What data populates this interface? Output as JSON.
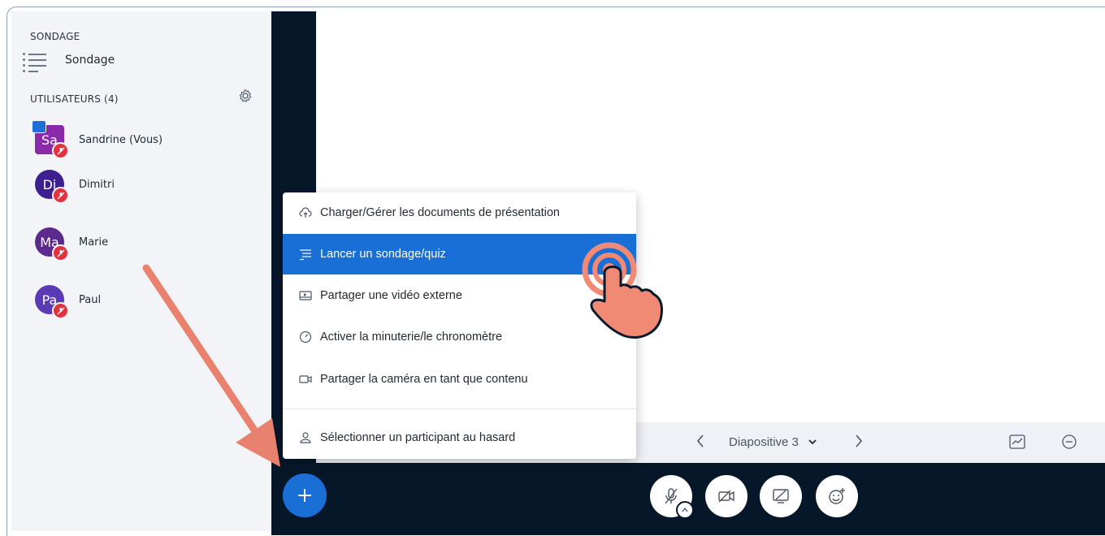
{
  "sidebar": {
    "poll_section_title": "SONDAGE",
    "poll_item_label": "Sondage",
    "users_section_title": "UTILISATEURS (4)",
    "users": [
      {
        "initials": "Sa",
        "name": "Sandrine (Vous)",
        "color": "#8a2aa8"
      },
      {
        "initials": "Di",
        "name": "Dimitri",
        "color": "#3d1f8f"
      },
      {
        "initials": "Ma",
        "name": "Marie",
        "color": "#5b2a8c"
      },
      {
        "initials": "Pa",
        "name": "Paul",
        "color": "#5a3ab5"
      }
    ]
  },
  "menu": {
    "items": [
      {
        "label": "Charger/Gérer les documents de présentation",
        "icon": "cloud-upload-icon"
      },
      {
        "label": "Lancer un sondage/quiz",
        "icon": "poll-icon"
      },
      {
        "label": "Partager une vidéo externe",
        "icon": "external-video-icon"
      },
      {
        "label": "Activer la minuterie/le chronomètre",
        "icon": "timer-icon"
      },
      {
        "label": "Partager la caméra en tant que contenu",
        "icon": "camera-icon"
      },
      {
        "label": "Sélectionner un participant au hasard",
        "icon": "user-icon"
      }
    ],
    "selected_index": 1
  },
  "slide_controls": {
    "slide_label": "Diapositive 3"
  },
  "colors": {
    "accent": "#1a6fd6",
    "dark_bg": "#06172a",
    "annotation": "#e8826e"
  }
}
